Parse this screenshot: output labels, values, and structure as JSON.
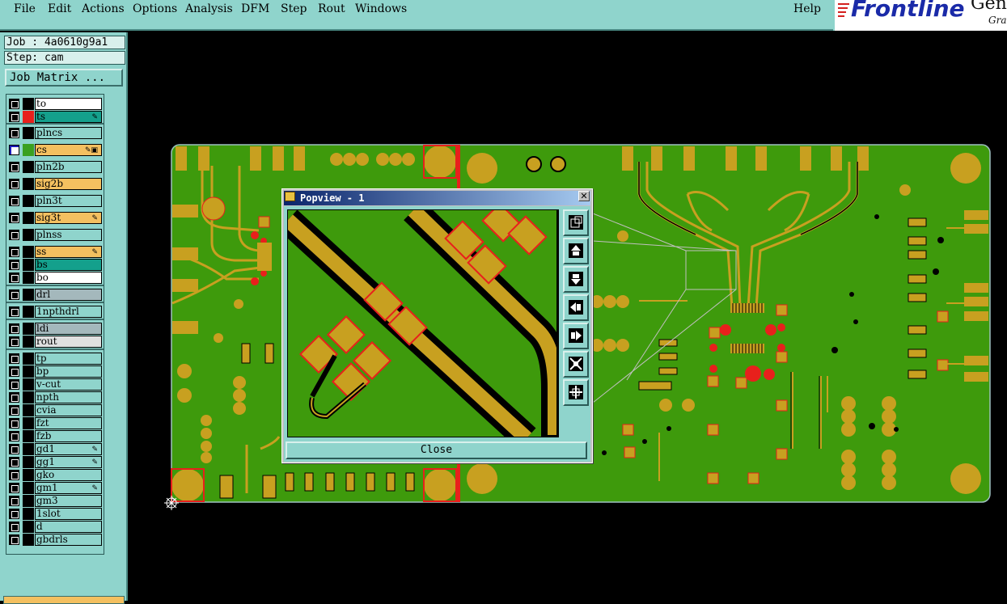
{
  "menubar": {
    "items": [
      {
        "label": "File"
      },
      {
        "label": "Edit"
      },
      {
        "label": "Actions"
      },
      {
        "label": "Options"
      },
      {
        "label": "Analysis"
      },
      {
        "label": "DFM"
      },
      {
        "label": "Step"
      },
      {
        "label": "Rout"
      },
      {
        "label": "Windows"
      }
    ],
    "help": "Help"
  },
  "logo": {
    "brand": "Frontline",
    "product": "Gen",
    "tagline": "Gra"
  },
  "left_panel": {
    "job": "Job : 4a0610g9a1",
    "step": "Step: cam",
    "job_matrix_button": "Job Matrix ...",
    "layers": [
      {
        "name": "to",
        "color": "#ffffff",
        "swatch": "#000000",
        "mark": ""
      },
      {
        "name": "ts",
        "color": "#14a08c",
        "swatch": "#e8201c",
        "mark": "✎"
      },
      {
        "name": "plncs",
        "color": "#8fd4cc",
        "swatch": "#000000",
        "mark": ""
      },
      {
        "name": "cs",
        "color": "#f4c060",
        "swatch": "#3aa020",
        "mark": "✎▣",
        "selected": true
      },
      {
        "name": "pln2b",
        "color": "#8fd4cc",
        "swatch": "#000000",
        "mark": ""
      },
      {
        "name": "sig2b",
        "color": "#f4c060",
        "swatch": "#000000",
        "mark": ""
      },
      {
        "name": "pln3t",
        "color": "#8fd4cc",
        "swatch": "#000000",
        "mark": ""
      },
      {
        "name": "sig3t",
        "color": "#f4c060",
        "swatch": "#000000",
        "mark": "✎"
      },
      {
        "name": "plnss",
        "color": "#8fd4cc",
        "swatch": "#000000",
        "mark": ""
      },
      {
        "name": "ss",
        "color": "#f4c060",
        "swatch": "#000000",
        "mark": "✎"
      },
      {
        "name": "bs",
        "color": "#14a08c",
        "swatch": "#000000",
        "mark": ""
      },
      {
        "name": "bo",
        "color": "#ffffff",
        "swatch": "#000000",
        "mark": ""
      },
      {
        "name": "drl",
        "color": "#a4b8bc",
        "swatch": "#000000",
        "mark": ""
      },
      {
        "name": "1npthdrl",
        "color": "#8fd4cc",
        "swatch": "#000000",
        "mark": ""
      },
      {
        "name": "ldi",
        "color": "#a4b8bc",
        "swatch": "#000000",
        "mark": ""
      },
      {
        "name": "rout",
        "color": "#e0e0e0",
        "swatch": "#000000",
        "mark": ""
      },
      {
        "name": "tp",
        "color": "#8fd4cc",
        "swatch": "#000000",
        "mark": ""
      },
      {
        "name": "bp",
        "color": "#8fd4cc",
        "swatch": "#000000",
        "mark": ""
      },
      {
        "name": "v-cut",
        "color": "#8fd4cc",
        "swatch": "#000000",
        "mark": ""
      },
      {
        "name": "npth",
        "color": "#8fd4cc",
        "swatch": "#000000",
        "mark": ""
      },
      {
        "name": "cvia",
        "color": "#8fd4cc",
        "swatch": "#000000",
        "mark": ""
      },
      {
        "name": "fzt",
        "color": "#8fd4cc",
        "swatch": "#000000",
        "mark": ""
      },
      {
        "name": "fzb",
        "color": "#8fd4cc",
        "swatch": "#000000",
        "mark": ""
      },
      {
        "name": "gd1",
        "color": "#8fd4cc",
        "swatch": "#000000",
        "mark": "✎"
      },
      {
        "name": "gg1",
        "color": "#8fd4cc",
        "swatch": "#000000",
        "mark": "✎"
      },
      {
        "name": "gko",
        "color": "#8fd4cc",
        "swatch": "#000000",
        "mark": ""
      },
      {
        "name": "gm1",
        "color": "#8fd4cc",
        "swatch": "#000000",
        "mark": "✎"
      },
      {
        "name": "gm3",
        "color": "#8fd4cc",
        "swatch": "#000000",
        "mark": ""
      },
      {
        "name": "1slot",
        "color": "#8fd4cc",
        "swatch": "#000000",
        "mark": ""
      },
      {
        "name": "d",
        "color": "#8fd4cc",
        "swatch": "#000000",
        "mark": ""
      },
      {
        "name": "gbdrls",
        "color": "#8fd4cc",
        "swatch": "#000000",
        "mark": ""
      }
    ]
  },
  "popview": {
    "title": "Popview - 1",
    "close_button": "Close",
    "tools": [
      "zoom-home-icon",
      "pan-up-icon",
      "pan-down-icon",
      "pan-left-icon",
      "pan-right-icon",
      "zoom-in-icon",
      "zoom-out-icon"
    ]
  },
  "colors": {
    "panel": "#8fd4cc",
    "board": "#3e9a0c",
    "copper": "#c8a020",
    "pad_red": "#e8201c",
    "title_bar": "#0a246a"
  }
}
